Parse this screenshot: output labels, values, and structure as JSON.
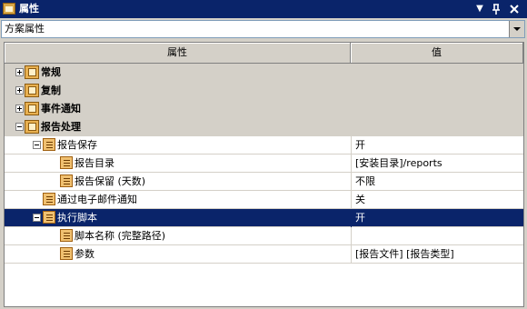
{
  "window": {
    "title": "属性"
  },
  "combo": {
    "value": "方案属性"
  },
  "columns": {
    "property": "属性",
    "value": "值"
  },
  "categories": {
    "general": "常规",
    "replication": "复制",
    "event_notification": "事件通知",
    "report_processing": "报告处理"
  },
  "rows": {
    "report_save": {
      "label": "报告保存",
      "value": "开"
    },
    "report_dir": {
      "label": "报告目录",
      "value": "[安装目录]/reports"
    },
    "report_keep": {
      "label": "报告保留 (天数)",
      "value": "不限"
    },
    "email_notify": {
      "label": "通过电子邮件通知",
      "value": "关"
    },
    "run_script": {
      "label": "执行脚本",
      "value": "开"
    },
    "script_name": {
      "label": "脚本名称 (完整路径)",
      "value": ""
    },
    "params": {
      "label": "参数",
      "value": "[报告文件] [报告类型]"
    }
  }
}
